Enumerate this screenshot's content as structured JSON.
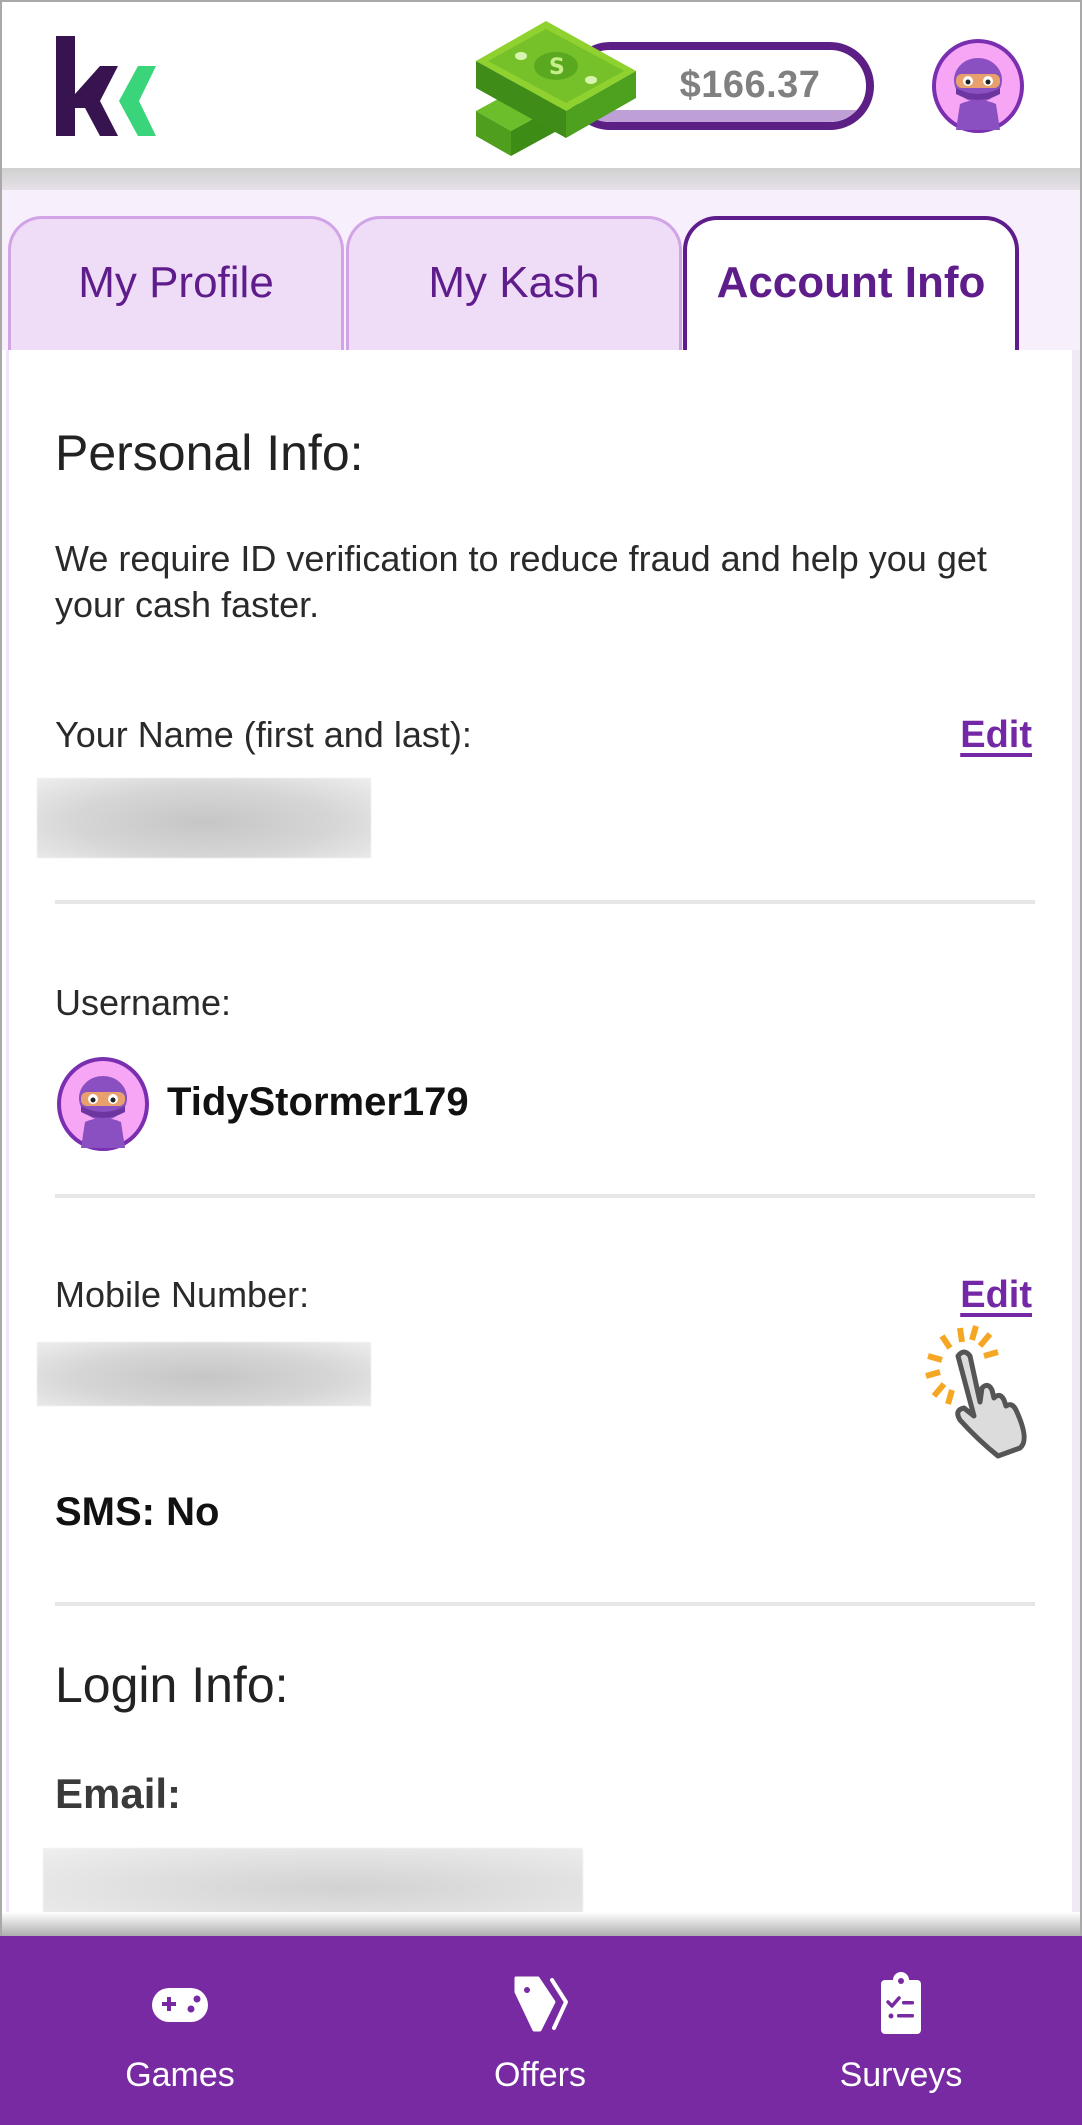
{
  "header": {
    "logo_alt": "Kashkick logo",
    "balance": "$166.37",
    "avatar_alt": "ninja avatar"
  },
  "tabs": [
    {
      "label": "My Profile",
      "active": false
    },
    {
      "label": "My Kash",
      "active": false
    },
    {
      "label": "Account Info",
      "active": true
    }
  ],
  "personal_info": {
    "heading": "Personal Info:",
    "description": "We require ID verification to reduce fraud and help you get your cash faster.",
    "name_label": "Your Name (first and last):",
    "name_edit": "Edit",
    "name_value": "",
    "username_label": "Username:",
    "username": "TidyStormer179",
    "mobile_label": "Mobile Number:",
    "mobile_edit": "Edit",
    "mobile_value": "",
    "sms_status": "SMS: No"
  },
  "login_info": {
    "heading": "Login Info:",
    "email_label": "Email:",
    "email_value": ""
  },
  "bottom_nav": [
    {
      "label": "Games",
      "icon": "gamepad-icon"
    },
    {
      "label": "Offers",
      "icon": "tags-icon"
    },
    {
      "label": "Surveys",
      "icon": "clipboard-checklist-icon"
    }
  ],
  "colors": {
    "brand_purple": "#772aa2",
    "dark_purple": "#5f1d8c",
    "link_purple": "#7428a5",
    "logo_green": "#3ad47a",
    "logo_dark": "#37134f"
  }
}
